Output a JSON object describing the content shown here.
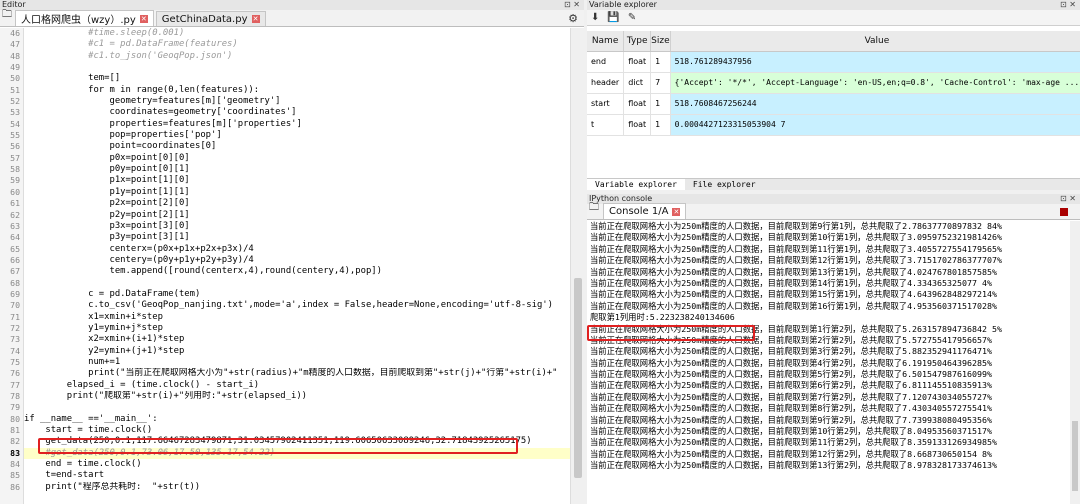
{
  "editor": {
    "title": "Editor",
    "controls": "⊡ ✕",
    "tabs": [
      {
        "label": "人口格网爬虫（wzy）.py",
        "active": true
      },
      {
        "label": "GetChinaData.py",
        "active": false
      }
    ],
    "gear": "⚙",
    "current_line": 83,
    "lines": [
      {
        "n": 46,
        "t": "            #time.sleep(0.001)",
        "cls": "c-com"
      },
      {
        "n": 47,
        "t": "            #c1 = pd.DataFrame(features)",
        "cls": "c-com"
      },
      {
        "n": 48,
        "t": "            #c1.to_json('GeoqPop.json')",
        "cls": "c-com"
      },
      {
        "n": 49,
        "t": ""
      },
      {
        "n": 50,
        "t": "            tem=[]"
      },
      {
        "n": 51,
        "t": "            for m in range(0,len(features)):"
      },
      {
        "n": 52,
        "t": "                geometry=features[m]['geometry']"
      },
      {
        "n": 53,
        "t": "                coordinates=geometry['coordinates']"
      },
      {
        "n": 54,
        "t": "                properties=features[m]['properties']"
      },
      {
        "n": 55,
        "t": "                pop=properties['pop']"
      },
      {
        "n": 56,
        "t": "                point=coordinates[0]"
      },
      {
        "n": 57,
        "t": "                p0x=point[0][0]"
      },
      {
        "n": 58,
        "t": "                p0y=point[0][1]"
      },
      {
        "n": 59,
        "t": "                p1x=point[1][0]"
      },
      {
        "n": 60,
        "t": "                p1y=point[1][1]"
      },
      {
        "n": 61,
        "t": "                p2x=point[2][0]"
      },
      {
        "n": 62,
        "t": "                p2y=point[2][1]"
      },
      {
        "n": 63,
        "t": "                p3x=point[3][0]"
      },
      {
        "n": 64,
        "t": "                p3y=point[3][1]"
      },
      {
        "n": 65,
        "t": "                centerx=(p0x+p1x+p2x+p3x)/4"
      },
      {
        "n": 66,
        "t": "                centery=(p0y+p1y+p2y+p3y)/4"
      },
      {
        "n": 67,
        "t": "                tem.append([round(centerx,4),round(centery,4),pop])"
      },
      {
        "n": 68,
        "t": ""
      },
      {
        "n": 69,
        "t": "            c = pd.DataFrame(tem)"
      },
      {
        "n": 70,
        "t": "            c.to_csv('GeoqPop_nanjing.txt',mode='a',index = False,header=None,encoding='utf-8-sig')"
      },
      {
        "n": 71,
        "t": "            x1=xmin+i*step"
      },
      {
        "n": 72,
        "t": "            y1=ymin+j*step"
      },
      {
        "n": 73,
        "t": "            x2=xmin+(i+1)*step"
      },
      {
        "n": 74,
        "t": "            y2=ymin+(j+1)*step"
      },
      {
        "n": 75,
        "t": "            num+=1"
      },
      {
        "n": 76,
        "t": "            print(\"当前正在爬取网格大小为\"+str(radius)+\"m精度的人口数据，目前爬取到第\"+str(j)+\"行第\"+str(i)+\""
      },
      {
        "n": 77,
        "t": "        elapsed_i = (time.clock() - start_i)"
      },
      {
        "n": 78,
        "t": "        print(\"爬取第\"+str(i)+\"列用时:\"+str(elapsed_i))"
      },
      {
        "n": 79,
        "t": ""
      },
      {
        "n": 80,
        "t": "if __name__ =='__main__':"
      },
      {
        "n": 81,
        "t": "    start = time.clock()"
      },
      {
        "n": 82,
        "t": "    get_data(250,0.1,117.66467283479871,31.03457902411351,119.60650633089246,32.71843925265175)"
      },
      {
        "n": 83,
        "t": "    #get_data(250,0.1,73.06,17.50,135.17,54.22)",
        "cls": "c-com"
      },
      {
        "n": 84,
        "t": "    end = time.clock()"
      },
      {
        "n": 85,
        "t": "    t=end-start"
      },
      {
        "n": 86,
        "t": "    print(\"程序总共耗时:  \"+str(t))"
      }
    ]
  },
  "variable_explorer": {
    "title": "Variable explorer",
    "controls": "⊡ ✕",
    "tool_icons": [
      "⬇",
      "💾",
      "✎"
    ],
    "columns": [
      "Name",
      "Type",
      "Size",
      "Value"
    ],
    "rows": [
      {
        "name": "end",
        "type": "float",
        "size": "1",
        "value": "518.761289437956",
        "kind": "num"
      },
      {
        "name": "header",
        "type": "dict",
        "size": "7",
        "value": "{'Accept': '*/*', 'Accept-Language': 'en-US,en;q=0.8', 'Cache-Control': 'max-age ...",
        "kind": "dict"
      },
      {
        "name": "start",
        "type": "float",
        "size": "1",
        "value": "518.7608467256244",
        "kind": "num"
      },
      {
        "name": "t",
        "type": "float",
        "size": "1",
        "value": "0.0004427123315053904 7",
        "kind": "num"
      }
    ],
    "bottom_tabs": [
      "Variable explorer",
      "File explorer"
    ]
  },
  "ipython": {
    "title": "IPython console",
    "controls": "⊡ ✕",
    "tab_label": "Console 1/A",
    "lines": [
      "当前正在爬取网格大小为250m精度的人口数据，目前爬取到第9行第1列，总共爬取了2.78637770897832 84%",
      "当前正在爬取网格大小为250m精度的人口数据，目前爬取到第10行第1列，总共爬取了3.0959752321981426%",
      "当前正在爬取网格大小为250m精度的人口数据，目前爬取到第11行第1列，总共爬取了3.4055727554179565%",
      "当前正在爬取网格大小为250m精度的人口数据，目前爬取到第12行第1列，总共爬取了3.7151702786377707%",
      "当前正在爬取网格大小为250m精度的人口数据，目前爬取到第13行第1列，总共爬取了4.024767801857585%",
      "当前正在爬取网格大小为250m精度的人口数据，目前爬取到第14行第1列，总共爬取了4.334365325077 4%",
      "当前正在爬取网格大小为250m精度的人口数据，目前爬取到第15行第1列，总共爬取了4.643962848297214%",
      "当前正在爬取网格大小为250m精度的人口数据，目前爬取到第16行第1列，总共爬取了4.953560371517028%",
      "爬取第1列用时:5.223238240134606",
      "当前正在爬取网格大小为250m精度的人口数据，目前爬取到第1行第2列，总共爬取了5.263157894736842 5%",
      "当前正在爬取网格大小为250m精度的人口数据，目前爬取到第2行第2列，总共爬取了5.572755417956657%",
      "当前正在爬取网格大小为250m精度的人口数据，目前爬取到第3行第2列，总共爬取了5.882352941176471%",
      "当前正在爬取网格大小为250m精度的人口数据，目前爬取到第4行第2列，总共爬取了6.191950464396285%",
      "当前正在爬取网格大小为250m精度的人口数据，目前爬取到第5行第2列，总共爬取了6.501547987616099%",
      "当前正在爬取网格大小为250m精度的人口数据，目前爬取到第6行第2列，总共爬取了6.811145510835913%",
      "当前正在爬取网格大小为250m精度的人口数据，目前爬取到第7行第2列，总共爬取了7.120743034055727%",
      "当前正在爬取网格大小为250m精度的人口数据，目前爬取到第8行第2列，总共爬取了7.430340557275541%",
      "当前正在爬取网格大小为250m精度的人口数据，目前爬取到第9行第2列，总共爬取了7.739938080495356%",
      "当前正在爬取网格大小为250m精度的人口数据，目前爬取到第10行第2列，总共爬取了8.04953560371517%",
      "当前正在爬取网格大小为250m精度的人口数据，目前爬取到第11行第2列，总共爬取了8.359133126934985%",
      "当前正在爬取网格大小为250m精度的人口数据，目前爬取到第12行第2列，总共爬取了8.668730650154 8%",
      "当前正在爬取网格大小为250m精度的人口数据，目前爬取到第13行第2列，总共爬取了8.978328173374613%"
    ]
  },
  "colors": {
    "highlight_box": "#e02020",
    "current_line": "#ffffc8",
    "value_cell": "#c8f0ff",
    "dict_cell": "#d8ffd8"
  }
}
